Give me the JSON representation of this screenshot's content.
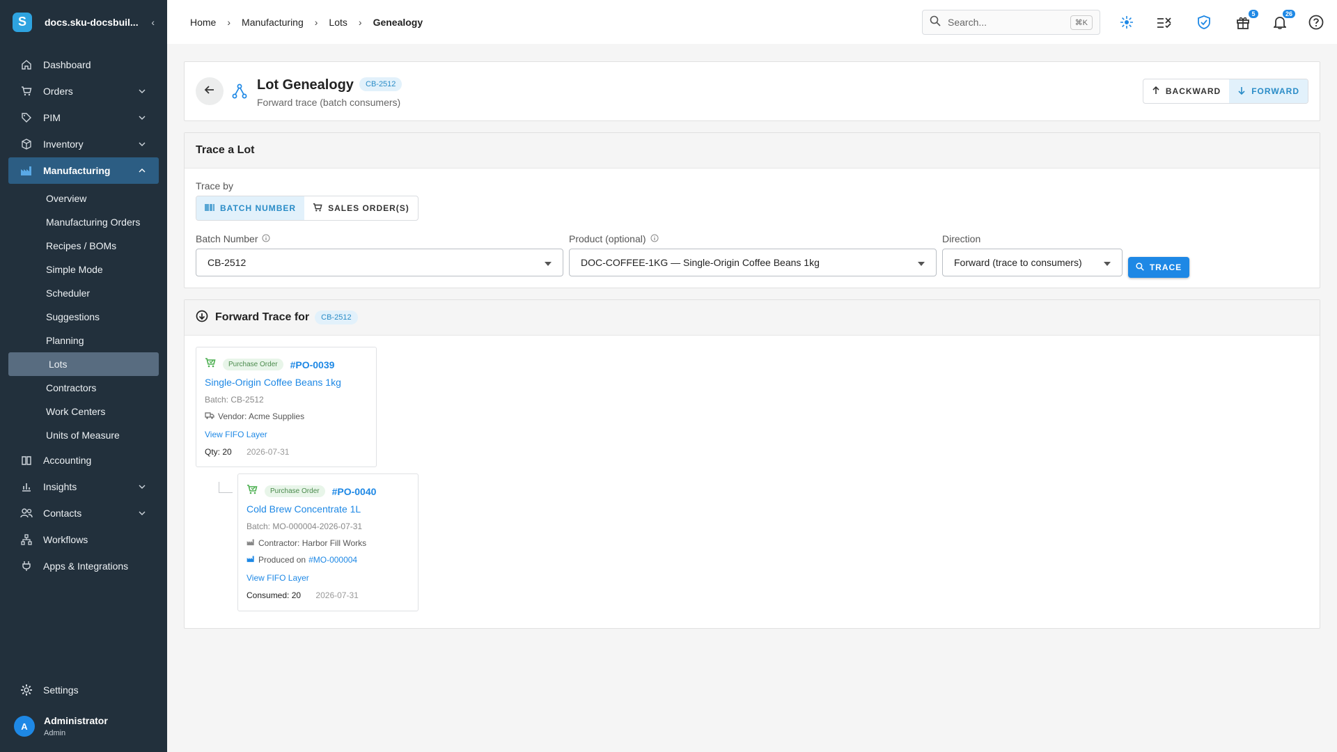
{
  "sidebar": {
    "org": "docs.sku-docsbuil...",
    "logo_letter": "S",
    "nav": [
      {
        "label": "Dashboard"
      },
      {
        "label": "Orders"
      },
      {
        "label": "PIM"
      },
      {
        "label": "Inventory"
      },
      {
        "label": "Manufacturing"
      }
    ],
    "sub": [
      {
        "label": "Overview"
      },
      {
        "label": "Manufacturing Orders"
      },
      {
        "label": "Recipes / BOMs"
      },
      {
        "label": "Simple Mode"
      },
      {
        "label": "Scheduler"
      },
      {
        "label": "Suggestions"
      },
      {
        "label": "Planning"
      },
      {
        "label": "Lots"
      },
      {
        "label": "Contractors"
      },
      {
        "label": "Work Centers"
      },
      {
        "label": "Units of Measure"
      }
    ],
    "nav2": [
      {
        "label": "Accounting"
      },
      {
        "label": "Insights"
      },
      {
        "label": "Contacts"
      },
      {
        "label": "Workflows"
      },
      {
        "label": "Apps & Integrations"
      }
    ],
    "settings": "Settings",
    "user": {
      "initial": "A",
      "name": "Administrator",
      "role": "Admin"
    }
  },
  "topbar": {
    "breadcrumb": [
      "Home",
      "Manufacturing",
      "Lots",
      "Genealogy"
    ],
    "search_placeholder": "Search...",
    "search_shortcut": "⌘K",
    "gift_badge": "5",
    "bell_badge": "26"
  },
  "header": {
    "title": "Lot Genealogy",
    "lot_chip": "CB-2512",
    "subtitle": "Forward trace (batch consumers)",
    "backward": "BACKWARD",
    "forward": "FORWARD"
  },
  "trace": {
    "title": "Trace a Lot",
    "trace_by_label": "Trace by",
    "batch_number_btn": "BATCH NUMBER",
    "sales_orders_btn": "SALES ORDER(S)",
    "batch_label": "Batch Number",
    "batch_value": "CB-2512",
    "product_label": "Product (optional)",
    "product_value": "DOC-COFFEE-1KG — Single-Origin Coffee Beans 1kg",
    "direction_label": "Direction",
    "direction_value": "Forward (trace to consumers)",
    "trace_btn": "TRACE"
  },
  "result": {
    "title": "Forward Trace for",
    "chip": "CB-2512",
    "nodes": [
      {
        "type": "Purchase Order",
        "po": "#PO-0039",
        "product": "Single-Origin Coffee Beans 1kg",
        "batch": "Batch: CB-2512",
        "line1": "Vendor: Acme Supplies",
        "fifo": "View FIFO Layer",
        "qty_label": "Qty:",
        "qty": "20",
        "date": "2026-07-31"
      },
      {
        "type": "Purchase Order",
        "po": "#PO-0040",
        "product": "Cold Brew Concentrate 1L",
        "batch": "Batch: MO-000004-2026-07-31",
        "line1": "Contractor: Harbor Fill Works",
        "line2": "Produced on",
        "line2_link": "#MO-000004",
        "fifo": "View FIFO Layer",
        "qty_label": "Consumed:",
        "qty": "20",
        "date": "2026-07-31"
      }
    ]
  }
}
